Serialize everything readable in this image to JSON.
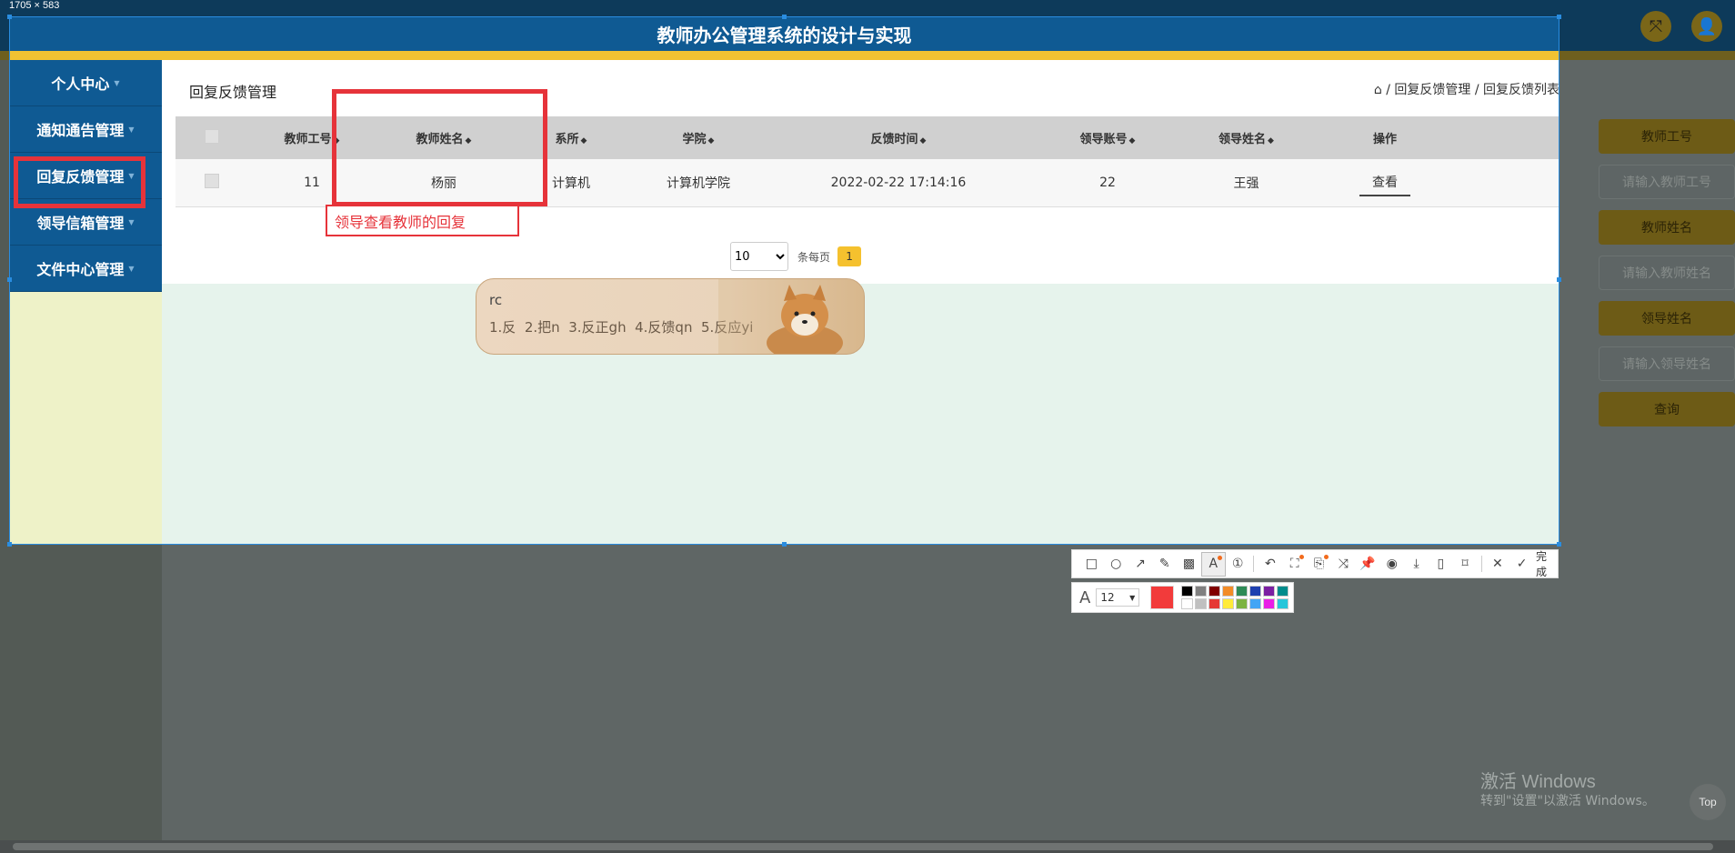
{
  "capture": {
    "size_label": "1705 × 583"
  },
  "app": {
    "title": "教师办公管理系统的设计与实现"
  },
  "sidebar": {
    "items": [
      {
        "label": "个人中心"
      },
      {
        "label": "通知通告管理"
      },
      {
        "label": "回复反馈管理"
      },
      {
        "label": "领导信箱管理"
      },
      {
        "label": "文件中心管理"
      }
    ]
  },
  "main": {
    "page_title": "回复反馈管理",
    "breadcrumb": {
      "sep": "/",
      "level1": "回复反馈管理",
      "level2": "回复反馈列表"
    }
  },
  "table": {
    "headers": {
      "teacher_id": "教师工号",
      "teacher_name": "教师姓名",
      "department": "系所",
      "college": "学院",
      "feedback_time": "反馈时间",
      "leader_account": "领导账号",
      "leader_name": "领导姓名",
      "action": "操作"
    },
    "rows": [
      {
        "teacher_id": "11",
        "teacher_name": "杨丽",
        "department": "计算机",
        "college": "计算机学院",
        "feedback_time": "2022-02-22 17:14:16",
        "leader_account": "22",
        "leader_name": "王强",
        "action": "查看"
      }
    ]
  },
  "pagination": {
    "page_size": "10",
    "per_page_label": "条每页",
    "current_page": "1"
  },
  "filters": {
    "teacher_id_label": "教师工号",
    "teacher_id_placeholder": "请输入教师工号",
    "teacher_name_label": "教师姓名",
    "teacher_name_placeholder": "请输入教师姓名",
    "leader_name_label": "领导姓名",
    "leader_name_placeholder": "请输入领导姓名",
    "search_button": "查询"
  },
  "annotation": {
    "text": "领导查看教师的回复"
  },
  "ime": {
    "input": "rc",
    "candidates": [
      "1.反",
      "2.把n",
      "3.反正gh",
      "4.反馈qn",
      "5.反应yi"
    ]
  },
  "toolbar": {
    "done_label": "完成",
    "font_size": "12",
    "current_color": "#f23b3b",
    "palette": [
      "#000000",
      "#808080",
      "#800000",
      "#f28c28",
      "#2e8b57",
      "#1e40af",
      "#7b1fa2",
      "#008b8b",
      "#ffffff",
      "#c0c0c0",
      "#e53935",
      "#ffeb3b",
      "#7cb342",
      "#42a5f5",
      "#e91ee6",
      "#26c6da"
    ]
  },
  "watermark": {
    "line1": "激活 Windows",
    "line2": "转到\"设置\"以激活 Windows。"
  },
  "scroll_top": {
    "label": "Top"
  },
  "colors": {
    "header_blue": "#0f5a93",
    "accent_yellow": "#f1c232",
    "annotation_red": "#e6333a"
  }
}
